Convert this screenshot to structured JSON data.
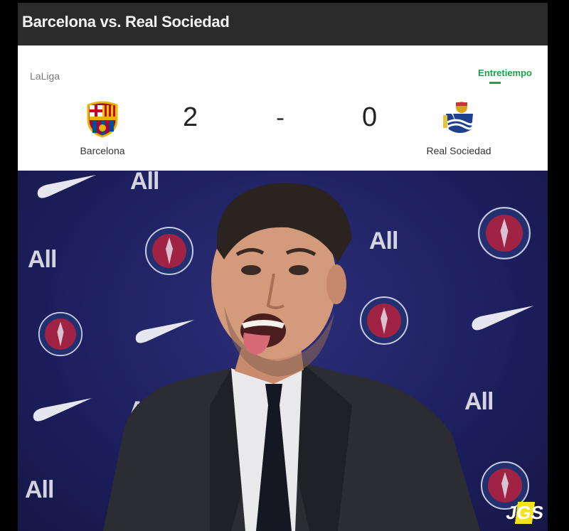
{
  "header": {
    "title": "Barcelona vs. Real Sociedad"
  },
  "match": {
    "league": "LaLiga",
    "status": "Entretiempo",
    "home": {
      "name": "Barcelona",
      "score": "2"
    },
    "away": {
      "name": "Real Sociedad",
      "score": "0"
    },
    "separator": "-"
  },
  "backdrop": {
    "sponsor_text": "All"
  },
  "watermark": {
    "text": "JGS"
  },
  "colors": {
    "status_green": "#1aa34a",
    "title_bar": "#2b2b2b",
    "backdrop_navy": "#1d1f5e"
  },
  "icons": [
    "barcelona-crest-icon",
    "real-sociedad-crest-icon",
    "psg-logo-icon",
    "nike-swoosh-icon"
  ]
}
